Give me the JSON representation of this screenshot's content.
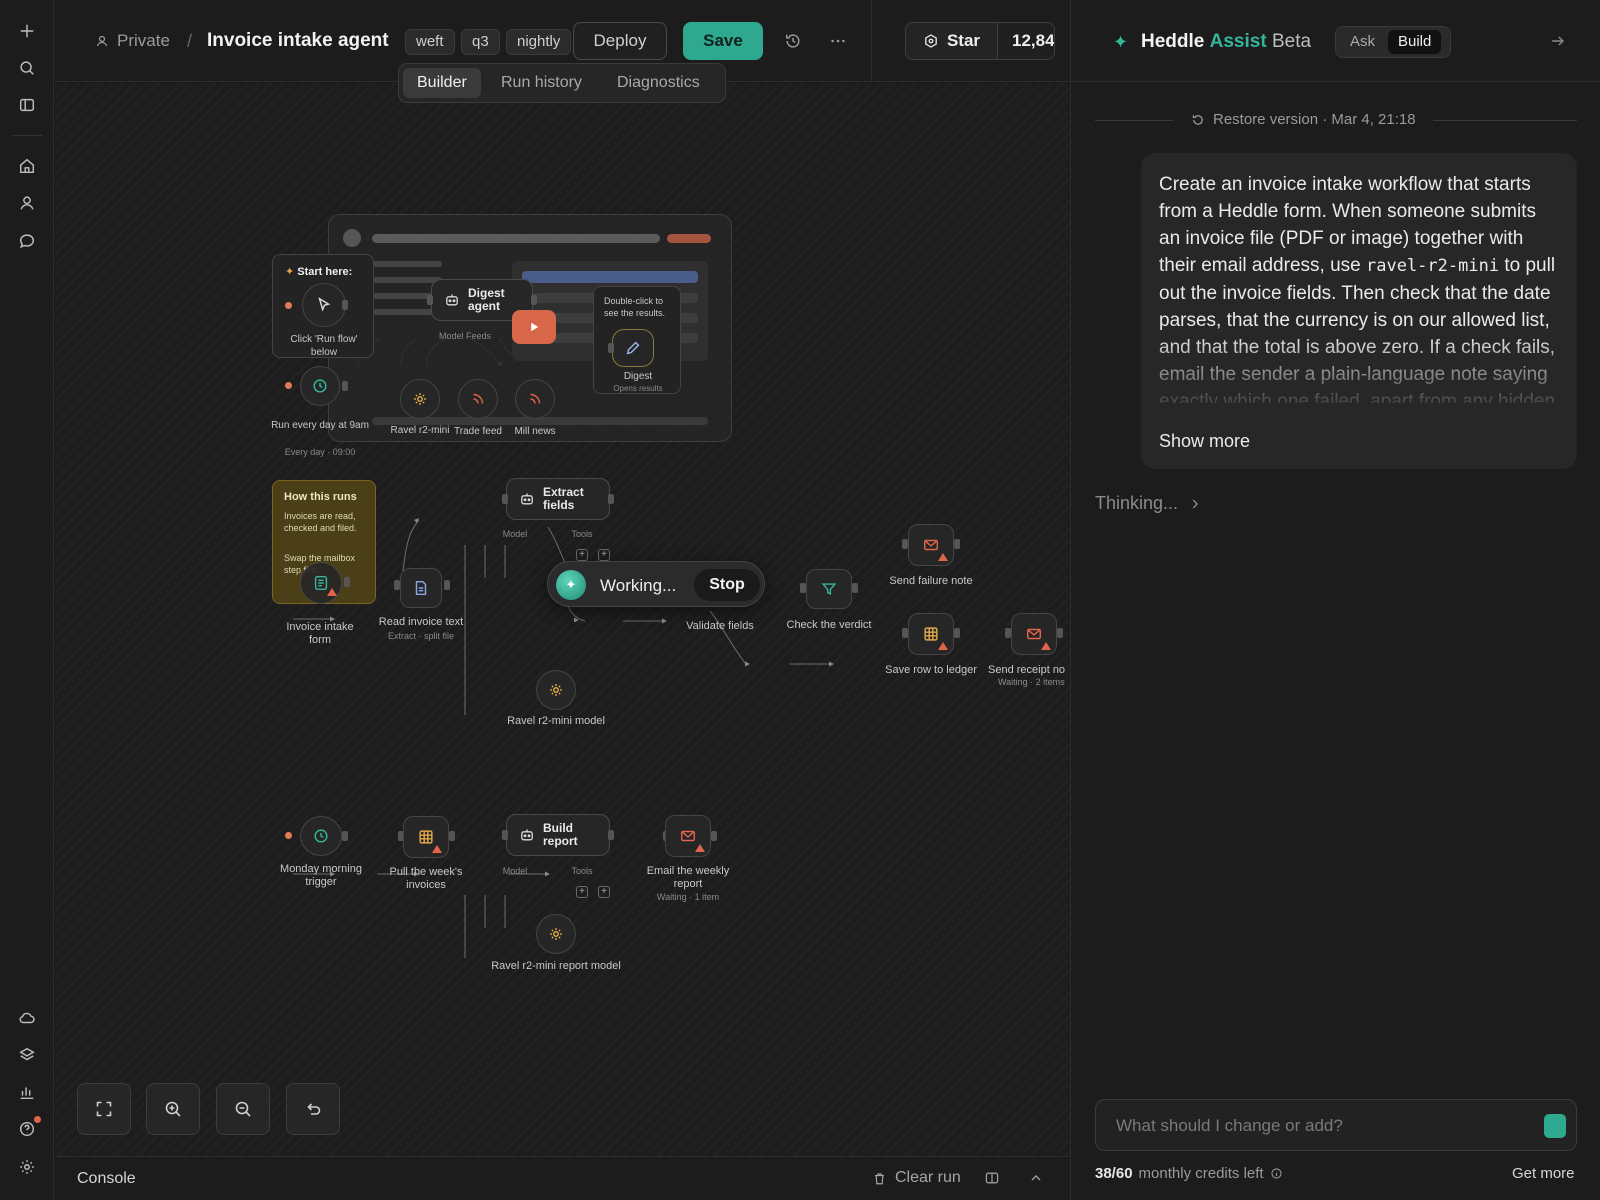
{
  "topbar": {
    "visibility": "Private",
    "separator": "/",
    "title": "Invoice intake agent",
    "tags": [
      "weft",
      "q3",
      "nightly"
    ],
    "deploy_label": "Deploy",
    "save_label": "Save",
    "star_label": "Star",
    "star_count": "12,84"
  },
  "tabs": [
    "Builder",
    "Run history",
    "Diagnostics"
  ],
  "tutorial": {
    "start_here": "Start here:",
    "start_hint": "Click 'Run flow' below",
    "digest_agent": "Digest agent",
    "digest_sub": "Model  Feeds",
    "tooltip": "Double-click to see the results.",
    "digest": "Digest",
    "digest_opens": "Opens results",
    "schedule_label": "Run every day at 9am",
    "schedule_sub": "Every day · 09:00",
    "ravel": "Ravel r2-mini",
    "trade_feed": "Trade feed",
    "mill_news": "Mill news"
  },
  "how_runs": {
    "title": "How this runs",
    "line1": "Invoices are read, checked and filed.",
    "line2": "Swap the mailbox step first."
  },
  "flow1": {
    "intake_form": "Invoice intake form",
    "read_text": "Read invoice text",
    "read_sub": "Extract · split file",
    "extract": "Extract fields",
    "model": "Model",
    "tools": "Tools",
    "validate": "Validate fields",
    "verdict": "Check the verdict",
    "failure": "Send failure note",
    "save_row": "Save row to ledger",
    "receipt": "Send receipt no",
    "receipt_sub": "Waiting · 2 items",
    "ravel_model": "Ravel r2-mini model"
  },
  "working": {
    "label": "Working...",
    "stop": "Stop"
  },
  "flow2": {
    "monday": "Monday morning trigger",
    "pull": "Pull the week's invoices",
    "build": "Build report",
    "model": "Model",
    "tools": "Tools",
    "email": "Email the weekly report",
    "email_sub": "Waiting · 1 item",
    "ravel_report": "Ravel r2-mini report model"
  },
  "console": {
    "label": "Console",
    "clear": "Clear run"
  },
  "assist": {
    "brand": "Heddle",
    "assist": "Assist",
    "beta": "Beta",
    "mode_ask": "Ask",
    "mode_build": "Build",
    "restore": "Restore version · Mar 4, 21:18",
    "message_a": "Create an invoice intake workflow that starts from a Heddle form. When someone submits an invoice file (PDF or image) together with their email address, use ",
    "message_code": "ravel-r2-mini",
    "message_b": " to pull out the invoice fields. Then check that the date parses, that the currency is on our allowed list, and that the total is above zero. If a check fails, email the sender a plain-language note saying exactly which one failed, apart from any hidden ticks, if",
    "show_more": "Show more",
    "thinking": "Thinking...",
    "input_placeholder": "What should I change or add?",
    "credits_count": "38/60",
    "credits_text": "monthly credits left",
    "get_more": "Get more"
  },
  "colors": {
    "accent": "#2fa890",
    "warning": "#e0644a",
    "note": "#4b3f17"
  }
}
